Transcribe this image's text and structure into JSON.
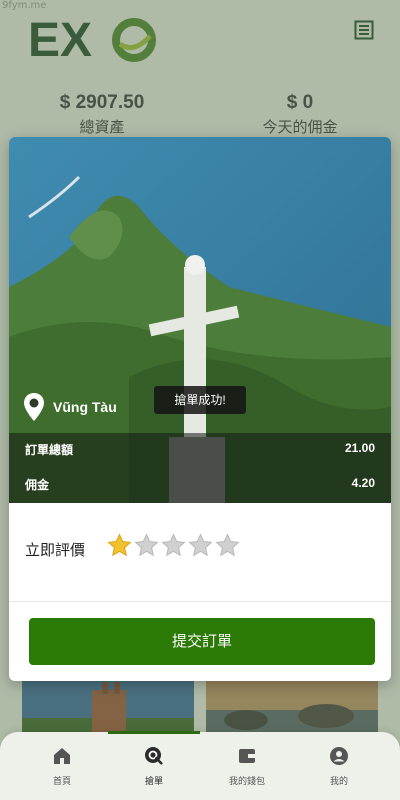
{
  "watermark_url": "9fym.me",
  "header": {
    "logo_text": "EXO",
    "menu_icon": "list-icon"
  },
  "stats": {
    "total_assets_value": "$ 2907.50",
    "total_assets_label": "總資產",
    "today_commission_value": "$ 0",
    "today_commission_label": "今天的佣金"
  },
  "modal": {
    "location_icon": "map-pin-icon",
    "location_name": "Vũng Tàu",
    "toast": "搶單成功!",
    "order_total_label": "訂單總額",
    "order_total_value": "21.00",
    "commission_label": "佣金",
    "commission_value": "4.20",
    "rating_label": "立即評價",
    "rating": 1,
    "rating_max": 5,
    "submit_label": "提交訂單"
  },
  "nav": {
    "items": [
      {
        "label": "首頁",
        "icon": "home-icon"
      },
      {
        "label": "搶單",
        "icon": "search-order-icon"
      },
      {
        "label": "我的錢包",
        "icon": "wallet-icon"
      },
      {
        "label": "我的",
        "icon": "user-icon"
      }
    ],
    "active_index": 1
  },
  "colors": {
    "accent": "#2b7a06",
    "star_active": "#f2c12e",
    "star_inactive": "#d0d0d0"
  }
}
